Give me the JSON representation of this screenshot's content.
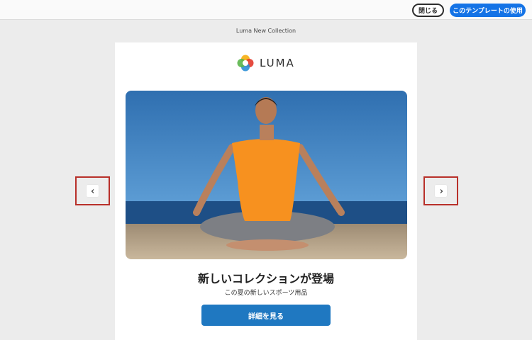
{
  "topbar": {
    "close_label": "閉じる",
    "use_template_label": "このテンプレートの使用"
  },
  "preview": {
    "title": "Luma New Collection"
  },
  "email": {
    "logo_text": "LUMA",
    "headline": "新しいコレクションが登場",
    "subheadline": "この夏の新しいスポーツ用品",
    "cta_label": "詳細を見る"
  },
  "colors": {
    "accent": "#1473e6",
    "cta": "#1f78c1",
    "highlight_frame": "#b8302a"
  },
  "icons": {
    "prev": "chevron-left-icon",
    "next": "chevron-right-icon"
  }
}
